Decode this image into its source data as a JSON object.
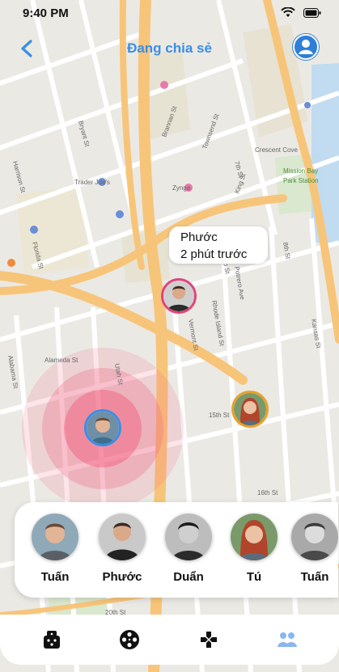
{
  "status_bar": {
    "time": "9:40 PM",
    "icons": [
      "wifi-icon",
      "battery-icon"
    ]
  },
  "header": {
    "title": "Đang chia sẻ",
    "back_icon": "chevron-left-icon",
    "profile_icon": "user-avatar-icon"
  },
  "map": {
    "labels": {
      "trader_joes": "Trader Joe's",
      "zynga": "Zynga",
      "crescent_cove": "Crescent Cove",
      "mission_bay": "Mission Bay",
      "mission_bay2": "Park Station",
      "alameda": "Alameda St",
      "fifteenth": "15th St",
      "sixteenth": "16th St",
      "utah": "Utah St",
      "kansas": "Kansas St",
      "de_haro": "De Haro St",
      "rhode_island": "Rhode Island St",
      "vermont": "Vermont St",
      "bryant": "Bryant St",
      "harrison": "Harrison St",
      "alabama": "Alabama St",
      "florida": "Florida St",
      "potrero": "Potrero Ave",
      "eighth": "8th St",
      "seventh": "7th St",
      "twentieth": "20th St",
      "townsend": "Townsend St",
      "brannan": "Brannan St",
      "king": "King St"
    }
  },
  "callout": {
    "name": "Phước",
    "time": "2 phút trước"
  },
  "friends": [
    {
      "name": "Tuấn"
    },
    {
      "name": "Phước"
    },
    {
      "name": "Duẩn"
    },
    {
      "name": "Tú"
    },
    {
      "name": "Tuấn"
    }
  ],
  "tabs": [
    {
      "icon": "dice-icon"
    },
    {
      "icon": "film-reel-icon"
    },
    {
      "icon": "gamepad-dpad-icon"
    },
    {
      "icon": "people-icon",
      "active": true
    }
  ],
  "colors": {
    "accent": "#3a8ee6",
    "highway": "#f7c57a",
    "pulse": "#f25c7c"
  }
}
